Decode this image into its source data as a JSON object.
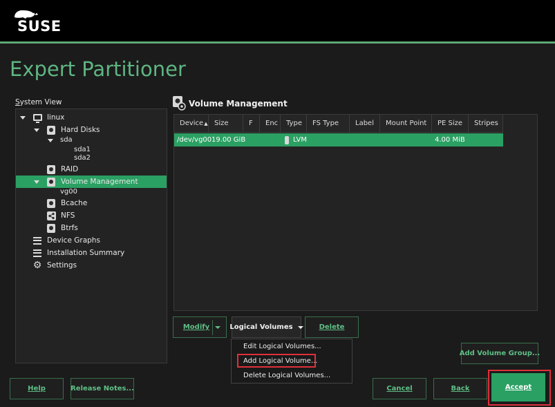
{
  "brand": {
    "logo_text": "SUSE",
    "accent": "#2ba063",
    "highlight": "#e0303a"
  },
  "page_title": "Expert Partitioner",
  "system_view": {
    "label_first": "S",
    "label_rest": "ystem View",
    "items": [
      {
        "label": "linux",
        "icon": "computer-icon"
      },
      {
        "label": "Hard Disks",
        "icon": "hard-disk-icon"
      },
      {
        "label": "sda"
      },
      {
        "label": "sda1"
      },
      {
        "label": "sda2"
      },
      {
        "label": "RAID",
        "icon": "raid-icon"
      },
      {
        "label": "Volume Management",
        "icon": "volume-management-icon",
        "selected": true
      },
      {
        "label": "vg00"
      },
      {
        "label": "Bcache",
        "icon": "bcache-icon"
      },
      {
        "label": "NFS",
        "icon": "nfs-share-icon"
      },
      {
        "label": "Btrfs",
        "icon": "btrfs-icon"
      },
      {
        "label": "Device Graphs",
        "icon": "list-icon"
      },
      {
        "label": "Installation Summary",
        "icon": "list-icon"
      },
      {
        "label": "Settings",
        "icon": "gear-icon"
      }
    ]
  },
  "main": {
    "title": "Volume Management",
    "columns": [
      "Device",
      "Size",
      "F",
      "Enc",
      "Type",
      "FS Type",
      "Label",
      "Mount Point",
      "PE Size",
      "Stripes"
    ],
    "sort_indicator": "▲",
    "rows": [
      {
        "device": "/dev/vg00",
        "size": "19.00 GiB",
        "f": "",
        "enc": "",
        "type": "LVM",
        "fs_type": "",
        "label": "",
        "mount_point": "",
        "pe_size": "4.00 MiB",
        "stripes": ""
      }
    ]
  },
  "buttons": {
    "modify": "Modify",
    "logical_volumes": "Logical Volumes",
    "delete": "Delete",
    "add_volume_group": "Add Volume Group...",
    "help": "Help",
    "release_notes": "Release Notes...",
    "cancel": "Cancel",
    "back": "Back",
    "accept": "Accept"
  },
  "menu": {
    "items": [
      "Edit Logical Volumes...",
      "Add Logical Volume...",
      "Delete Logical Volumes..."
    ],
    "highlighted_index": 1
  }
}
